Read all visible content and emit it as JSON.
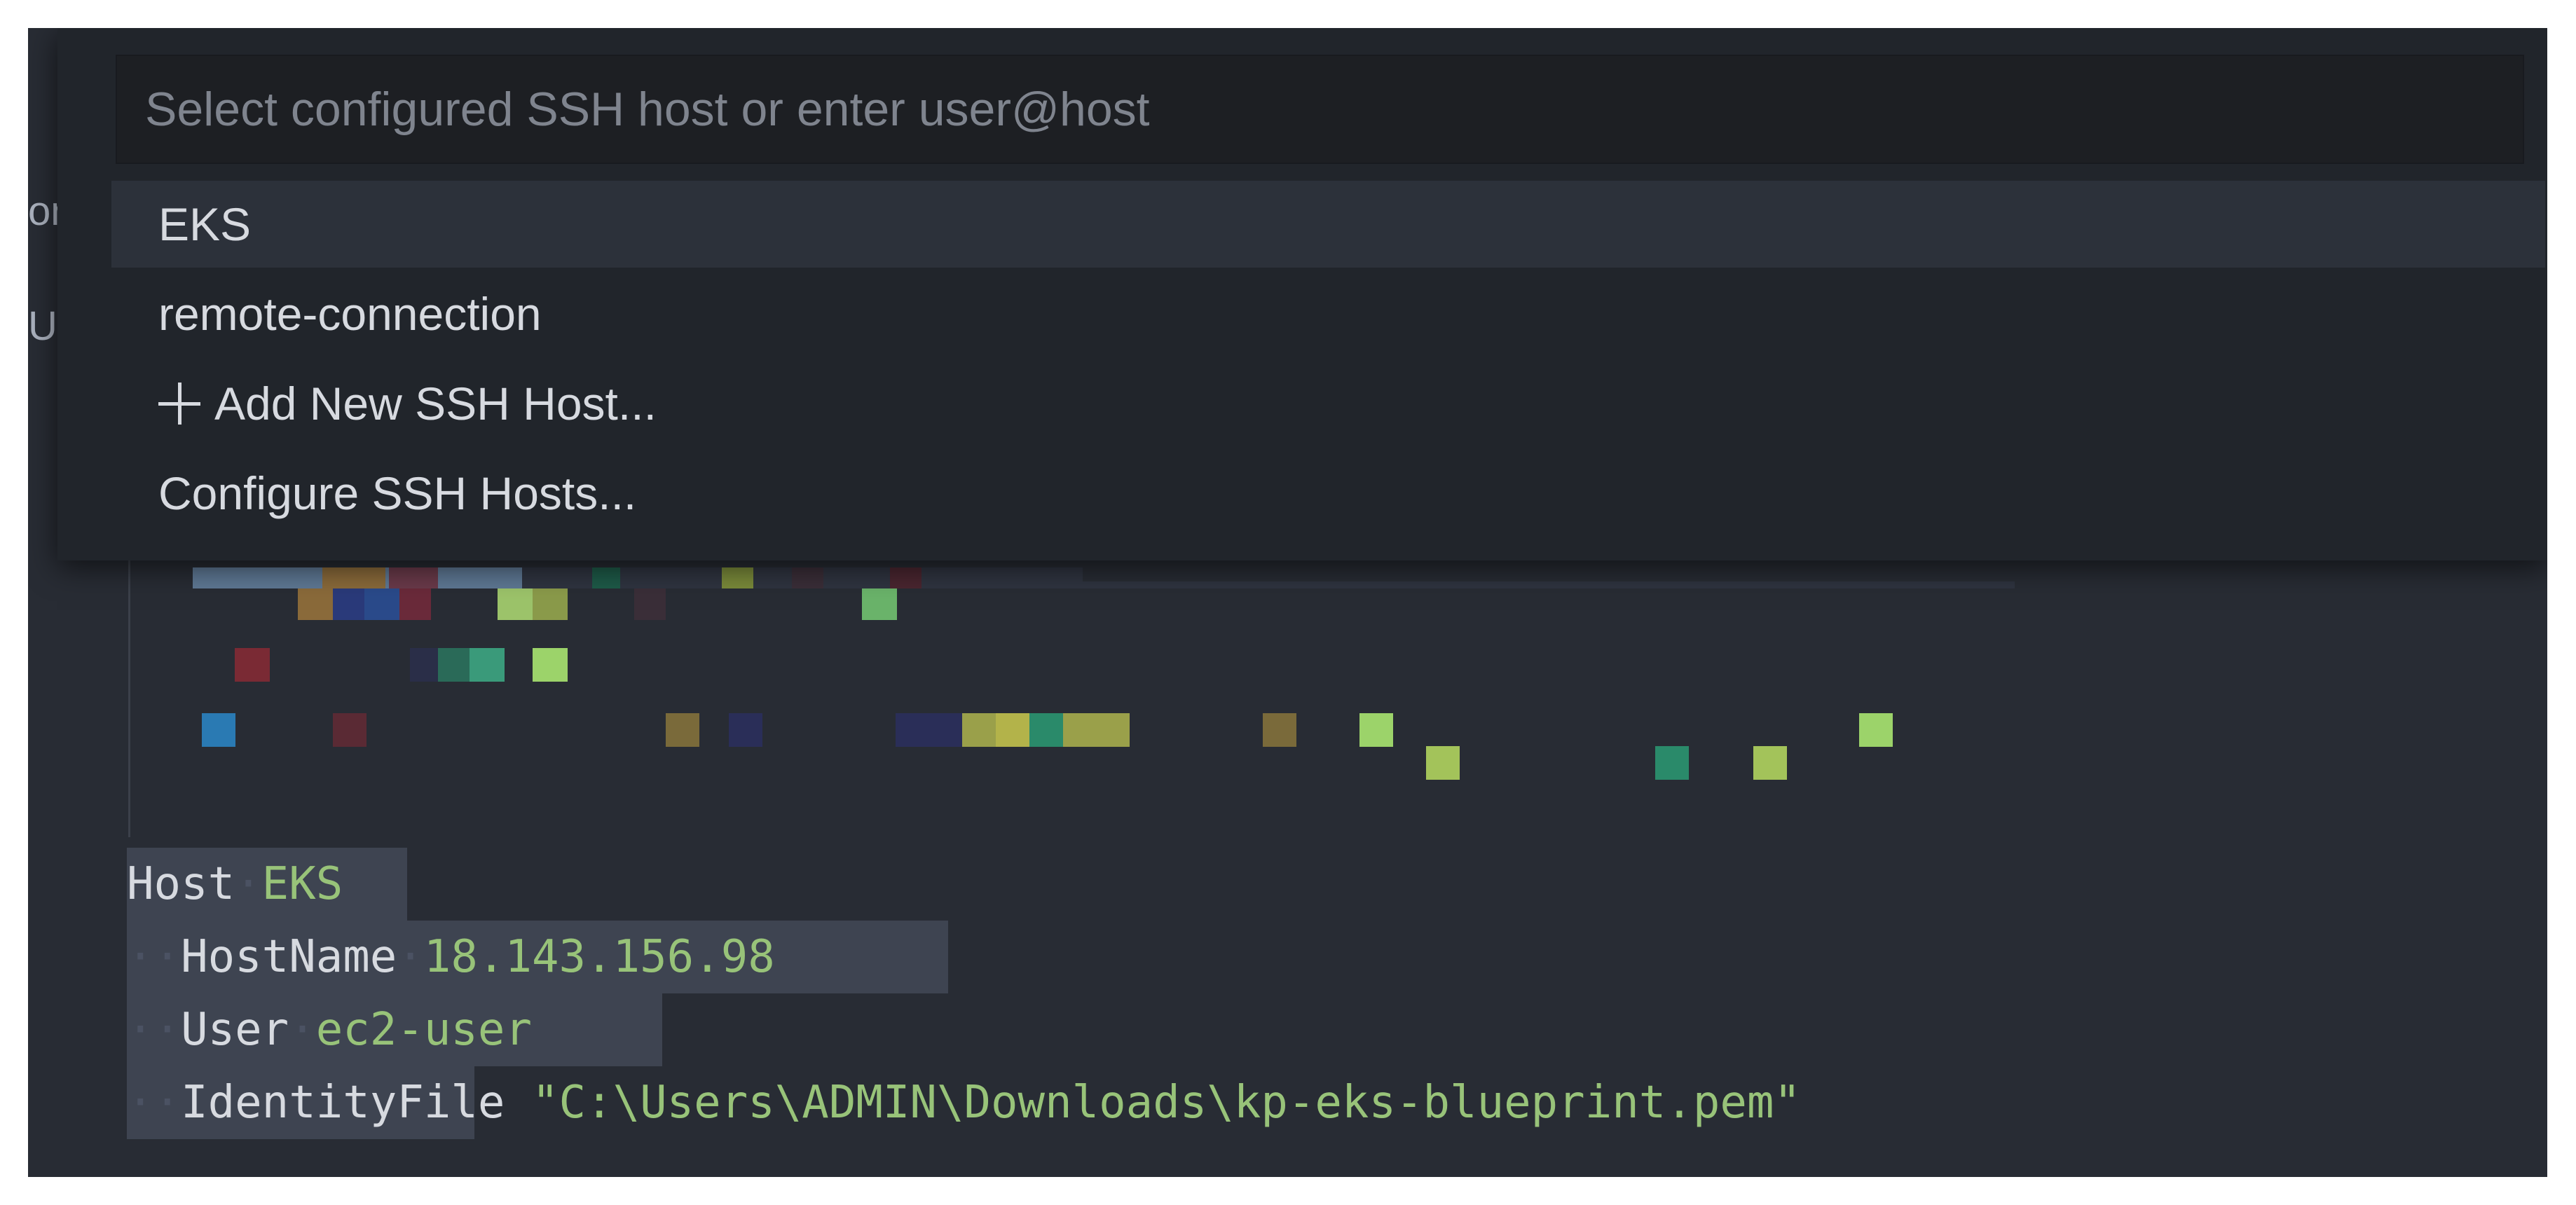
{
  "sidebar_fragments": [
    "on",
    "U"
  ],
  "quick_pick": {
    "placeholder": "Select configured SSH host or enter user@host",
    "items": [
      {
        "label": "EKS",
        "active": true
      },
      {
        "label": "remote-connection",
        "active": false
      },
      {
        "label": "Add New SSH Host...",
        "icon": "plus-icon",
        "active": false
      },
      {
        "label": "Configure SSH Hosts...",
        "active": false
      }
    ]
  },
  "editor": {
    "lines": [
      {
        "key": "Host",
        "value": "EKS"
      },
      {
        "key": "HostName",
        "value": "18.143.156.98"
      },
      {
        "key": "User",
        "value": "ec2-user"
      },
      {
        "key": "IdentityFile",
        "value": "\"C:\\Users\\ADMIN\\Downloads\\kp-eks-blueprint.pem\""
      }
    ]
  },
  "colors": {
    "background": "#282c34",
    "quickpick_bg": "#21252b",
    "selection": "#3e4451",
    "string": "#98c379"
  }
}
